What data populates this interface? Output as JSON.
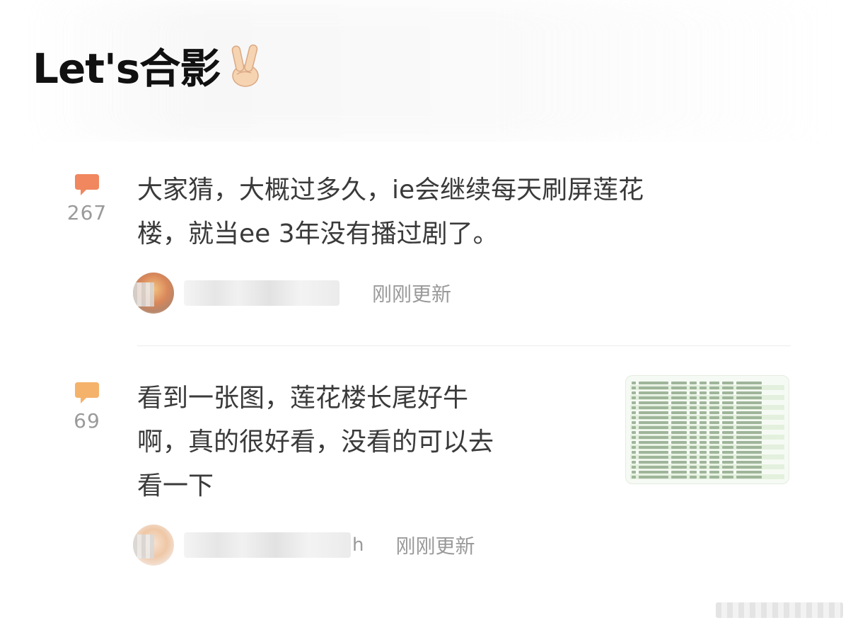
{
  "post": {
    "title": "Let's合影",
    "title_emoji": "victory-hand-icon"
  },
  "comments": [
    {
      "count": "267",
      "icon": "speech-bubble-icon",
      "icon_color": "#f0875f",
      "line1": "大家猜，大概过多久，ie会继续每天刷屏莲花",
      "line2": "楼，就当ee 3年没有播过剧了。",
      "author_tail": "",
      "time": "刚刚更新"
    },
    {
      "count": "69",
      "icon": "speech-bubble-icon",
      "icon_color": "#f5b26b",
      "line1": "看到一张图，莲花楼长尾好牛",
      "line2": "啊，真的很好看，没看的可以去",
      "line3": "看一下",
      "author_tail": "h",
      "time": "刚刚更新",
      "has_thumbnail": true
    }
  ],
  "colors": {
    "title_text": "#111111",
    "body_text": "#3a3a3a",
    "muted_text": "#9a9a9a",
    "divider": "#ececec"
  }
}
